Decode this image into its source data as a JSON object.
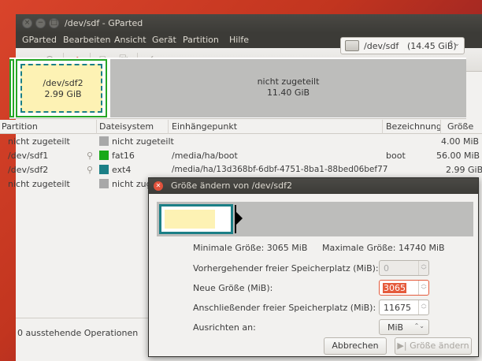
{
  "window": {
    "title": "/dev/sdf - GParted"
  },
  "menu": [
    "GParted",
    "Bearbeiten",
    "Ansicht",
    "Gerät",
    "Partition",
    "Hilfe"
  ],
  "device": {
    "path": "/dev/sdf",
    "size": "(14.45 GiB)"
  },
  "graph": {
    "p1_name": "/dev/sdf2",
    "p1_size": "2.99 GiB",
    "unalloc_name": "nicht zugeteilt",
    "unalloc_size": "11.40 GiB"
  },
  "table": {
    "headers": [
      "Partition",
      "Dateisystem",
      "Einhängepunkt",
      "Bezeichnung",
      "Größe"
    ],
    "rows": [
      {
        "partition": "nicht zugeteilt",
        "fs": "nicht zugeteilt",
        "fs_color": "#a8a8a8",
        "mount": "",
        "label": "",
        "size": "4.00 MiB"
      },
      {
        "partition": "/dev/sdf1",
        "fs": "fat16",
        "fs_color": "#18a818",
        "mount": "/media/ha/boot",
        "label": "boot",
        "size": "56.00 MiB"
      },
      {
        "partition": "/dev/sdf2",
        "fs": "ext4",
        "fs_color": "#1b7f86",
        "mount": "/media/ha/13d368bf-6dbf-4751-8ba1-88bed06bef77",
        "label": "",
        "size": "2.99 GiB"
      },
      {
        "partition": "nicht zugeteilt",
        "fs": "nicht zug",
        "fs_color": "#a8a8a8",
        "mount": "",
        "label": "",
        "size": ""
      }
    ]
  },
  "status": "0 ausstehende Operationen",
  "dialog": {
    "title": "Größe ändern von /dev/sdf2",
    "min_label": "Minimale Größe: 3065 MiB",
    "max_label": "Maximale Größe: 14740 MiB",
    "fields": {
      "free_before_label": "Vorhergehender freier Speicherplatz (MiB):",
      "free_before_value": "0",
      "new_size_label": "Neue Größe (MiB):",
      "new_size_value": "3065",
      "free_after_label": "Anschließender freier Speicherplatz (MiB):",
      "free_after_value": "11675",
      "align_label": "Ausrichten an:",
      "align_value": "MiB"
    },
    "cancel_label": "Abbrechen",
    "resize_label": "Größe ändern"
  },
  "colors": {
    "accent": "#e55b3c",
    "ext4": "#1b7f86",
    "fat16": "#18a818",
    "partition_fill": "#fdf2b4"
  }
}
